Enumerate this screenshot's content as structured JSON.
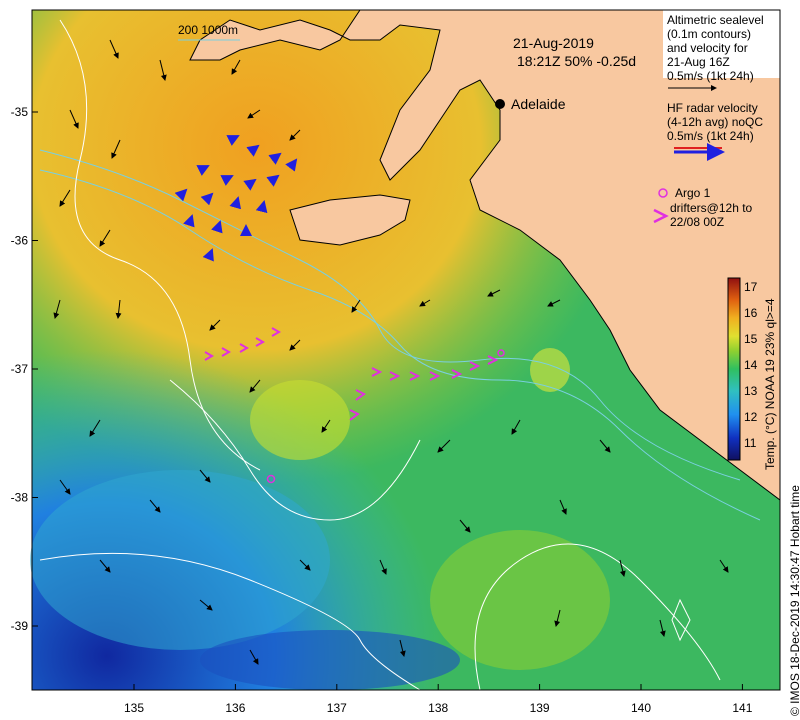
{
  "map": {
    "date": "21-Aug-2019",
    "time_line": "18:21Z  50% -0.25d",
    "city": "Adelaide",
    "bathy_legend": "200  1000m",
    "altimetry_legend": [
      "Altimetric sealevel",
      "(0.1m contours)",
      "and velocity for",
      "21-Aug 16Z",
      "0.5m/s (1kt 24h)"
    ],
    "radar_legend": [
      "HF radar velocity",
      "(4-12h avg) noQC",
      "0.5m/s (1kt 24h)"
    ],
    "argo_label": "Argo 1",
    "drifter_legend": [
      "drifters@12h to",
      "22/08 00Z"
    ],
    "colorbar_label": "Temp. (°C) NOAA 19 23% ql>=4",
    "colorbar_ticks": [
      "11",
      "12",
      "13",
      "14",
      "15",
      "16",
      "17"
    ],
    "x_ticks": [
      "135",
      "136",
      "137",
      "138",
      "139",
      "140",
      "141"
    ],
    "y_ticks": [
      "-35",
      "-36",
      "-37",
      "-38",
      "-39"
    ],
    "credit": "© IMOS 18-Dec-2019 14:30:47 Hobart time",
    "colors": {
      "land": "#f8c8a0",
      "coastline": "#000000",
      "radar_arrow": "#2020e0",
      "drifter": "#e030e0",
      "contour": "#ffffff"
    }
  }
}
